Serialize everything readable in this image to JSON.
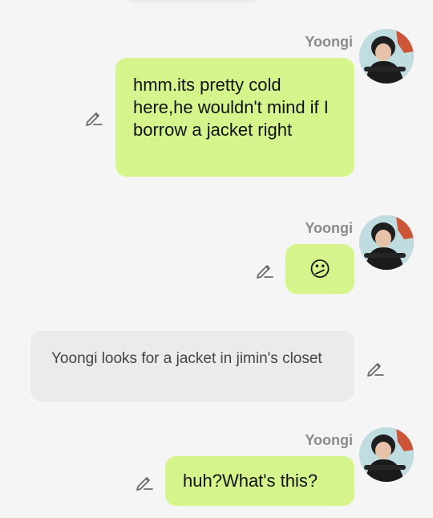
{
  "messages": [
    {
      "sender": "Yoongi",
      "text": "hmm.its pretty cold here,he wouldn't mind if I borrow a jacket right"
    },
    {
      "sender": "Yoongi",
      "text": "😕"
    },
    {
      "text": "Yoongi looks for a jacket in jimin's closet"
    },
    {
      "sender": "Yoongi",
      "text": "huh?What's this?"
    }
  ],
  "colors": {
    "background": "#f5f5f5",
    "user_bubble": "#d5f48c",
    "narration_bubble": "#ebebeb",
    "sender_name": "#8a8a8a"
  },
  "icons": {
    "edit": "pencil-edit-icon",
    "avatar": "profile-avatar"
  }
}
